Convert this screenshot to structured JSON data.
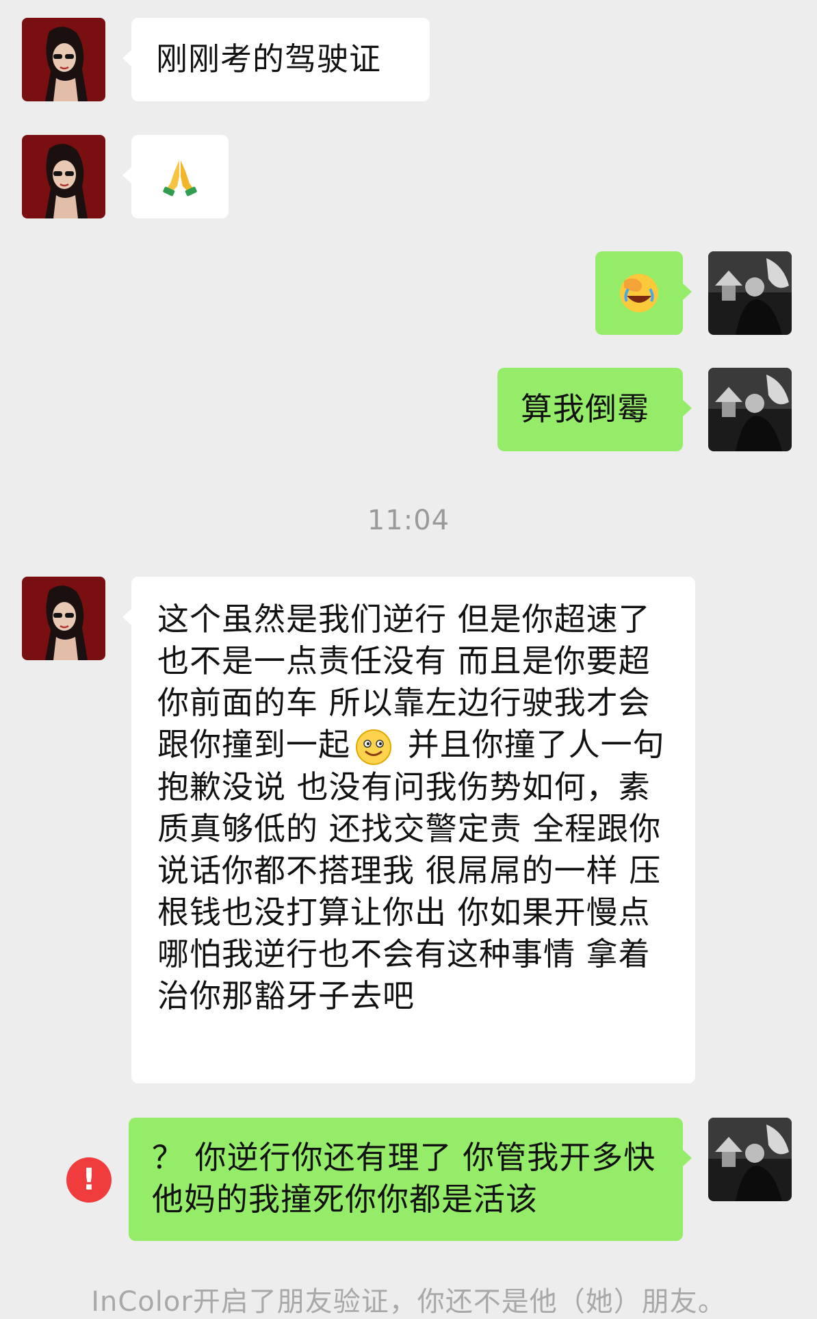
{
  "messages": [
    {
      "side": "left",
      "type": "text",
      "text": "刚刚考的驾驶证"
    },
    {
      "side": "left",
      "type": "emoji",
      "emoji": "🙏",
      "icon": "folded-hands-icon"
    },
    {
      "side": "right",
      "type": "emoji",
      "emoji": "😂",
      "icon": "facepalm-laugh-icon"
    },
    {
      "side": "right",
      "type": "text",
      "text": "算我倒霉"
    },
    {
      "side": "left",
      "type": "text",
      "text_before": "这个虽然是我们逆行 但是你超速了 也不是一点责任没有 而且是你要超你前面的车 所以靠左边行驶我才会跟你撞到一起",
      "inline_emoji": "slight-smile-icon",
      "text_after": " 并且你撞了人一句抱歉没说 也没有问我伤势如何，素质真够低的 还找交警定责 全程跟你说话你都不搭理我 很屌屌的一样 压根钱也没打算让你出 你如果开慢点哪怕我逆行也不会有这种事情 拿着治你那豁牙子去吧"
    },
    {
      "side": "right",
      "type": "text",
      "text": "？ 你逆行你还有理了 你管我开多快 他妈的我撞死你你都是活该",
      "failed": true
    }
  ],
  "timestamp": "11:04",
  "error_badge": "!",
  "system_note": "InColor开启了朋友验证，你还不是他（她）朋友。",
  "colors": {
    "background": "#ededed",
    "bubble_self": "#95ec69",
    "bubble_other": "#ffffff",
    "error": "#f03c3c"
  }
}
